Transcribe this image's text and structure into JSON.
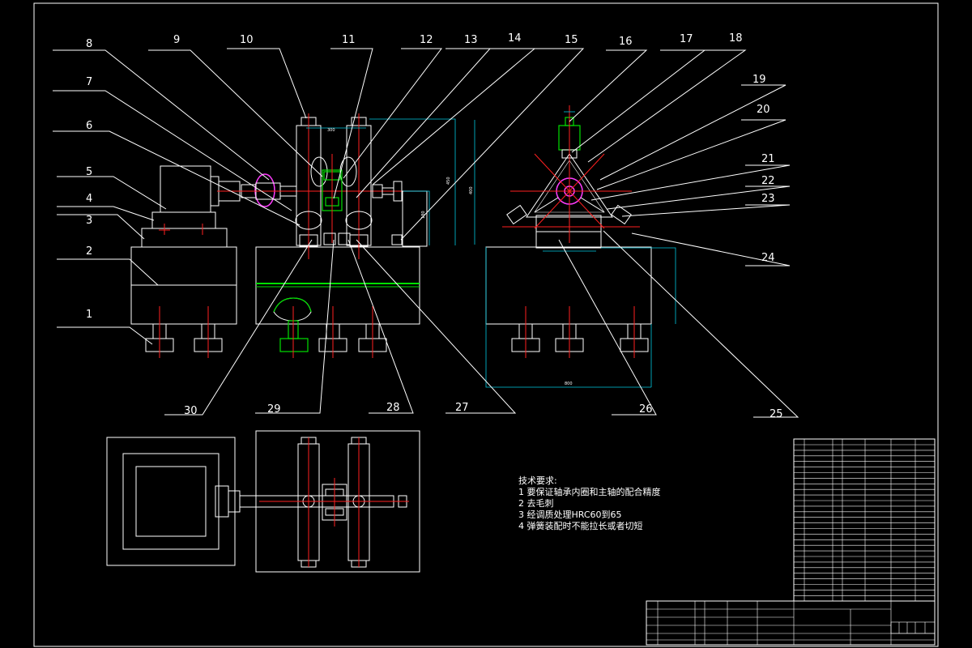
{
  "labels": {
    "n1": "1",
    "n2": "2",
    "n3": "3",
    "n4": "4",
    "n5": "5",
    "n6": "6",
    "n7": "7",
    "n8": "8",
    "n9": "9",
    "n10": "10",
    "n11": "11",
    "n12": "12",
    "n13": "13",
    "n14": "14",
    "n15": "15",
    "n16": "16",
    "n17": "17",
    "n18": "18",
    "n19": "19",
    "n20": "20",
    "n21": "21",
    "n22": "22",
    "n23": "23",
    "n24": "24",
    "n25": "25",
    "n26": "26",
    "n27": "27",
    "n28": "28",
    "n29": "29",
    "n30": "30"
  },
  "requirements": {
    "title": "技术要求:",
    "items": [
      "1 要保证轴承内圈和主轴的配合精度",
      "2 去毛刺",
      "3 经调质处理HRC60到65",
      "4 弹簧装配时不能拉长或者切短"
    ]
  },
  "colors": {
    "background": "#000000",
    "lines": "#ffffff",
    "centerlines": "#ff2020",
    "dimensions": "#00c8e0",
    "parts_green": "#00e000",
    "parts_magenta": "#ff3cff"
  }
}
